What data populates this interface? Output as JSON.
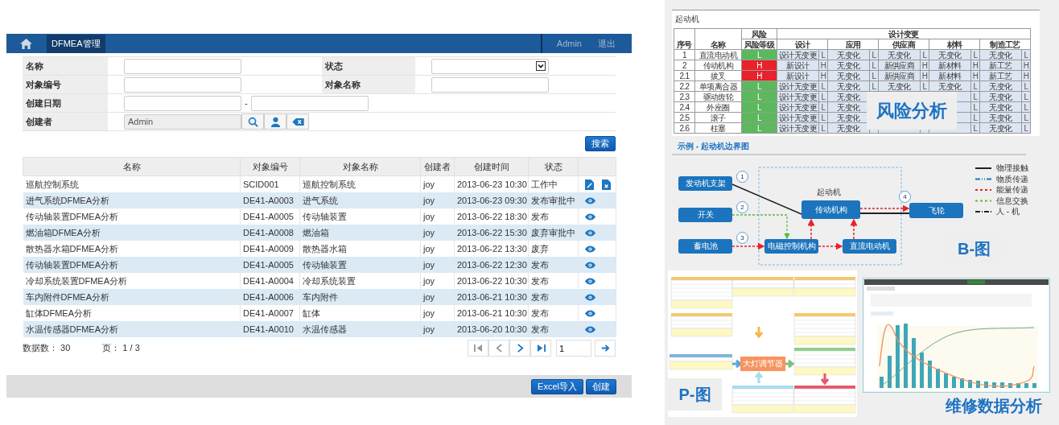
{
  "app": {
    "header": {
      "tab": "DFMEA管理",
      "user": "Admin",
      "logout": "退出"
    },
    "filters": [
      {
        "label": "名称",
        "kind": "text"
      },
      {
        "label": "状态",
        "kind": "select"
      },
      {
        "label": "对象编号",
        "kind": "text"
      },
      {
        "label": "对象名称",
        "kind": "text"
      },
      {
        "label": "创建日期",
        "kind": "range",
        "separator": "-"
      },
      {
        "label": "创建者",
        "kind": "user",
        "value": "Admin"
      }
    ],
    "search_button": "搜索",
    "table": {
      "columns": [
        "名称",
        "对象编号",
        "对象名称",
        "创建者",
        "创建时间",
        "状态"
      ],
      "rows": [
        {
          "cells": [
            "巡航控制系统",
            "SCID001",
            "巡航控制系统",
            "joy",
            "2013-06-23 10:30",
            "工作中"
          ],
          "actions": [
            {
              "kind": "edit"
            },
            {
              "kind": "delete"
            }
          ]
        },
        {
          "cells": [
            "进气系统DFMEA分析",
            "DE41-A0003",
            "进气系统",
            "joy",
            "2013-06-23 09:30",
            "发布审批中"
          ],
          "actions": [
            {
              "kind": "view"
            }
          ]
        },
        {
          "cells": [
            "传动轴装置DFMEA分析",
            "DE41-A0005",
            "传动轴装置",
            "joy",
            "2013-06-22 18:30",
            "发布"
          ],
          "actions": [
            {
              "kind": "view"
            }
          ]
        },
        {
          "cells": [
            "燃油箱DFMEA分析",
            "DE41-A0008",
            "燃油箱",
            "joy",
            "2013-06-22 15:30",
            "废弃审批中"
          ],
          "actions": [
            {
              "kind": "view"
            }
          ]
        },
        {
          "cells": [
            "散热器水箱DFMEA分析",
            "DE41-A0009",
            "散热器水箱",
            "joy",
            "2013-06-22 13:30",
            "废弃"
          ],
          "actions": [
            {
              "kind": "view"
            }
          ]
        },
        {
          "cells": [
            "传动轴装置DFMEA分析",
            "DE41-A0005",
            "传动轴装置",
            "joy",
            "2013-06-22 12:30",
            "发布"
          ],
          "actions": [
            {
              "kind": "view"
            }
          ]
        },
        {
          "cells": [
            "冷却系统装置DFMEA分析",
            "DE41-A0004",
            "冷却系统装置",
            "joy",
            "2013-06-22 10:30",
            "发布"
          ],
          "actions": [
            {
              "kind": "view"
            }
          ]
        },
        {
          "cells": [
            "车内附件DFMEA分析",
            "DE41-A0006",
            "车内附件",
            "joy",
            "2013-06-21 10:30",
            "发布"
          ],
          "actions": [
            {
              "kind": "view"
            }
          ]
        },
        {
          "cells": [
            "缸体DFMEA分析",
            "DE41-A0007",
            "缸体",
            "joy",
            "2013-06-21 10:30",
            "发布"
          ],
          "actions": [
            {
              "kind": "view"
            }
          ]
        },
        {
          "cells": [
            "水温传感器DFMEA分析",
            "DE41-A0010",
            "水温传感器",
            "joy",
            "2013-06-20 10:30",
            "发布"
          ],
          "actions": [
            {
              "kind": "view"
            }
          ]
        }
      ]
    },
    "pagination": {
      "total": "数据数： 30",
      "pages": "页： 1 / 3",
      "page_input": "1"
    },
    "footer_buttons": [
      "Excel导入",
      "创建"
    ]
  },
  "risk_panel": {
    "title": "起动机",
    "group_risk": "风险",
    "group_change": "设计变更",
    "columns": [
      "序号",
      "名称",
      "风险等级"
    ],
    "change_columns": [
      "设计",
      "应用",
      "供应商",
      "材料",
      "制造工艺"
    ],
    "rows": [
      {
        "no": "1",
        "name": "直流电动机",
        "risk": "L",
        "color": "#5cb85c",
        "design": {
          "value": "设计无变更",
          "level": "L"
        },
        "application": {
          "value": "无变化",
          "level": "L"
        },
        "supplier": {
          "value": "无变化",
          "level": "L"
        },
        "material": {
          "value": "无变化",
          "level": "L"
        },
        "process": {
          "value": "无变化",
          "level": "L"
        }
      },
      {
        "no": "2",
        "name": "传动机构",
        "risk": "H",
        "color": "#e8212b",
        "design": {
          "value": "新设计",
          "level": "H"
        },
        "application": {
          "value": "无变化",
          "level": "L"
        },
        "supplier": {
          "value": "新供应商",
          "level": "H"
        },
        "material": {
          "value": "新材料",
          "level": "H"
        },
        "process": {
          "value": "新工艺",
          "level": "H"
        }
      },
      {
        "no": "2.1",
        "name": "拔叉",
        "risk": "H",
        "color": "#e8212b",
        "design": {
          "value": "新设计",
          "level": "H"
        },
        "application": {
          "value": "无变化",
          "level": "L"
        },
        "supplier": {
          "value": "新供应商",
          "level": "H"
        },
        "material": {
          "value": "新材料",
          "level": "H"
        },
        "process": {
          "value": "新工艺",
          "level": "H"
        }
      },
      {
        "no": "2.2",
        "name": "单项离合器",
        "risk": "L",
        "color": "#5cb85c",
        "design": {
          "value": "设计无变更",
          "level": "L"
        },
        "application": {
          "value": "无变化",
          "level": "L"
        },
        "supplier": {
          "value": "无变化",
          "level": "L"
        },
        "material": {
          "value": "无变化",
          "level": "L"
        },
        "process": {
          "value": "无变化",
          "level": "L"
        }
      },
      {
        "no": "2.3",
        "name": "驱动齿轮",
        "risk": "L",
        "color": "#5cb85c",
        "design": {
          "value": "设计无变更",
          "level": "L"
        },
        "application": {
          "value": "无变化"
        },
        "material": {
          "level": "L"
        },
        "process": {
          "value": "无变化",
          "level": "L"
        }
      },
      {
        "no": "2.4",
        "name": "外座圈",
        "risk": "L",
        "color": "#5cb85c",
        "design": {
          "value": "设计无变更",
          "level": "L"
        },
        "application": {
          "value": "无变化"
        },
        "material": {
          "level": "L"
        },
        "process": {
          "value": "无变化",
          "level": "L"
        }
      },
      {
        "no": "2.5",
        "name": "滚子",
        "risk": "L",
        "color": "#5cb85c",
        "design": {
          "value": "设计无变更",
          "level": "L"
        },
        "application": {
          "value": "无变化"
        },
        "material": {
          "level": "L"
        },
        "process": {
          "value": "无变化",
          "level": "L"
        }
      },
      {
        "no": "2.6",
        "name": "柱塞",
        "risk": "L",
        "color": "#5cb85c",
        "design": {
          "value": "设计无变更",
          "level": "L"
        },
        "application": {
          "value": "无变化"
        },
        "material": {
          "level": "L"
        },
        "process": {
          "value": "无变化",
          "level": "L"
        }
      }
    ],
    "badge": "风险分析"
  },
  "boundary_diagram": {
    "title": "示例 - 起动机边界图",
    "system_label": "起动机",
    "nodes": [
      {
        "label": "发动机支架"
      },
      {
        "label": "开关"
      },
      {
        "label": "蓄电池"
      },
      {
        "label": "传动机构"
      },
      {
        "label": "飞轮"
      },
      {
        "label": "电磁控制机构"
      },
      {
        "label": "直流电动机"
      }
    ],
    "markers": [
      "1",
      "2",
      "3",
      "4"
    ],
    "legend": [
      {
        "label": "物理接触",
        "kind": "solid"
      },
      {
        "label": "物质传递",
        "kind": "dashdot-blue"
      },
      {
        "label": "能量传递",
        "kind": "dash-red"
      },
      {
        "label": "信息交换",
        "kind": "dash-green"
      },
      {
        "label": "人 - 机",
        "kind": "dashdot-black"
      }
    ],
    "badge": "B-图"
  },
  "p_diagram": {
    "center": "大灯调节器",
    "badge": "P-图"
  },
  "repair_chart": {
    "caption": "维修数据分析"
  }
}
